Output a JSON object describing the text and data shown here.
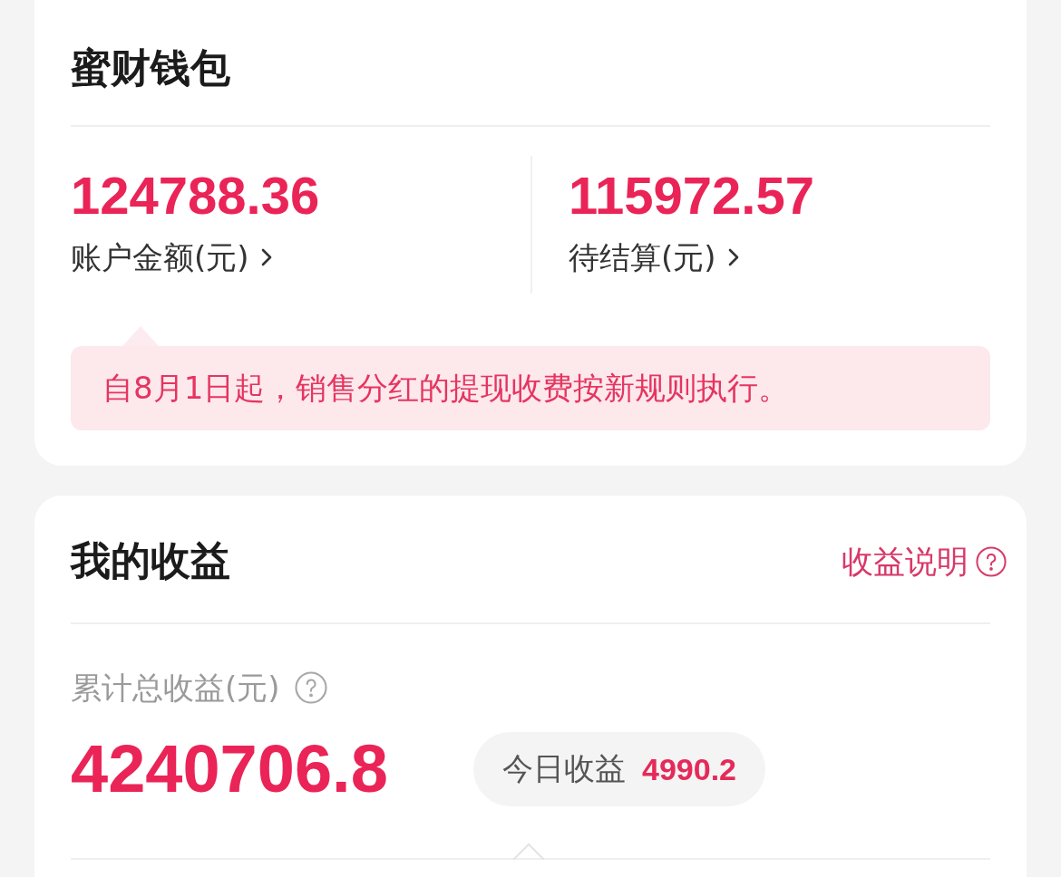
{
  "wallet": {
    "title": "蜜财钱包",
    "balances": [
      {
        "amount": "124788.36",
        "label": "账户金额(元)"
      },
      {
        "amount": "115972.57",
        "label": "待结算(元)"
      }
    ],
    "notice": "自8月1日起，销售分红的提现收费按新规则执行。"
  },
  "earnings": {
    "title": "我的收益",
    "help_link": "收益说明",
    "total_label": "累计总收益(元)",
    "total_amount": "4240706.8",
    "today": {
      "label": "今日收益",
      "amount": "4990.2"
    }
  }
}
